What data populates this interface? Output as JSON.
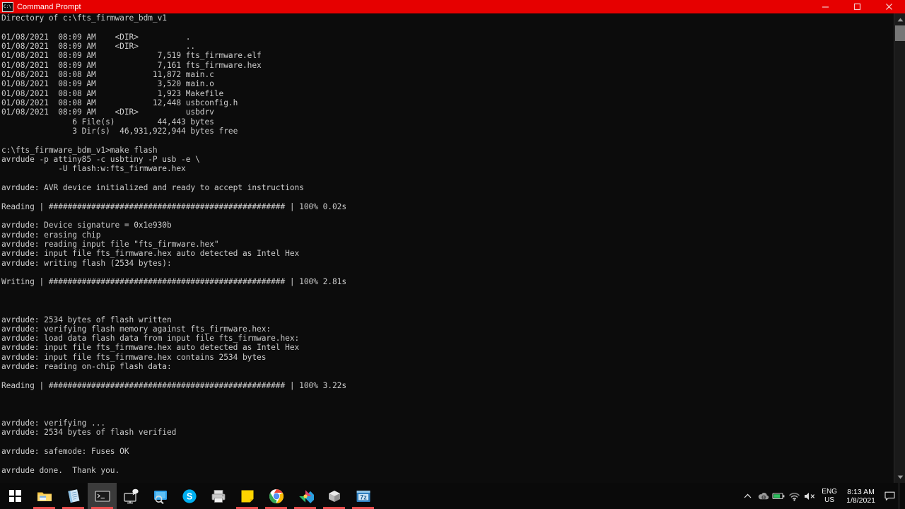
{
  "window": {
    "title": "Command Prompt",
    "icon": "command-prompt-icon",
    "titlebar_color": "#e60000",
    "minimize_label": "Minimize",
    "maximize_label": "Maximize",
    "close_label": "Close"
  },
  "console": {
    "background_color": "#0c0c0c",
    "text_color": "#cccccc",
    "content": "Directory of c:\\fts_firmware_bdm_v1\n\n01/08/2021  08:09 AM    <DIR>          .\n01/08/2021  08:09 AM    <DIR>          ..\n01/08/2021  08:09 AM             7,519 fts_firmware.elf\n01/08/2021  08:09 AM             7,161 fts_firmware.hex\n01/08/2021  08:08 AM            11,872 main.c\n01/08/2021  08:09 AM             3,520 main.o\n01/08/2021  08:08 AM             1,923 Makefile\n01/08/2021  08:08 AM            12,448 usbconfig.h\n01/08/2021  08:09 AM    <DIR>          usbdrv\n               6 File(s)         44,443 bytes\n               3 Dir(s)  46,931,922,944 bytes free\n\nc:\\fts_firmware_bdm_v1>make flash\navrdude -p attiny85 -c usbtiny -P usb -e \\\n            -U flash:w:fts_firmware.hex\n\navrdude: AVR device initialized and ready to accept instructions\n\nReading | ################################################## | 100% 0.02s\n\navrdude: Device signature = 0x1e930b\navrdude: erasing chip\navrdude: reading input file \"fts_firmware.hex\"\navrdude: input file fts_firmware.hex auto detected as Intel Hex\navrdude: writing flash (2534 bytes):\n\nWriting | ################################################## | 100% 2.81s\n\n\n\navrdude: 2534 bytes of flash written\navrdude: verifying flash memory against fts_firmware.hex:\navrdude: load data flash data from input file fts_firmware.hex:\navrdude: input file fts_firmware.hex auto detected as Intel Hex\navrdude: input file fts_firmware.hex contains 2534 bytes\navrdude: reading on-chip flash data:\n\nReading | ################################################## | 100% 3.22s\n\n\n\navrdude: verifying ...\navrdude: 2534 bytes of flash verified\n\navrdude: safemode: Fuses OK\n\navrdude done.  Thank you.\n"
  },
  "scrollbar": {
    "up_arrow": "▲",
    "down_arrow": "▼"
  },
  "taskbar": {
    "start_label": "Start",
    "items": [
      {
        "name": "file-explorer",
        "label": "File Explorer",
        "running": true
      },
      {
        "name": "notepad-plus-plus",
        "label": "Notepad++",
        "running": true
      },
      {
        "name": "command-prompt",
        "label": "Command Prompt",
        "running": true,
        "active": true
      },
      {
        "name": "remote-desktop",
        "label": "Remote Desktop",
        "running": false
      },
      {
        "name": "screen-capture",
        "label": "Screen Capture",
        "running": false
      },
      {
        "name": "skype",
        "label": "Skype",
        "running": false
      },
      {
        "name": "printer-utility",
        "label": "Printer Utility",
        "running": false
      },
      {
        "name": "sticky-notes",
        "label": "Sticky Notes",
        "running": true
      },
      {
        "name": "google-chrome",
        "label": "Google Chrome",
        "running": true
      },
      {
        "name": "paint-3d",
        "label": "Paint 3D",
        "running": true
      },
      {
        "name": "3d-printer-slicer",
        "label": "3D Printer Slicer",
        "running": true
      },
      {
        "name": "seven-zip",
        "label": "7-Zip File Manager",
        "running": true
      }
    ],
    "tray": {
      "chevron": "show-hidden-icons",
      "icons": [
        {
          "name": "onedrive-icon",
          "label": "OneDrive"
        },
        {
          "name": "battery-icon",
          "label": "Battery"
        },
        {
          "name": "network-icon",
          "label": "Network"
        },
        {
          "name": "volume-muted-icon",
          "label": "Volume muted"
        }
      ],
      "language": {
        "line1": "ENG",
        "line2": "US"
      },
      "clock": {
        "time": "8:13 AM",
        "date": "1/8/2021"
      },
      "action_center": "action-center-icon"
    }
  }
}
